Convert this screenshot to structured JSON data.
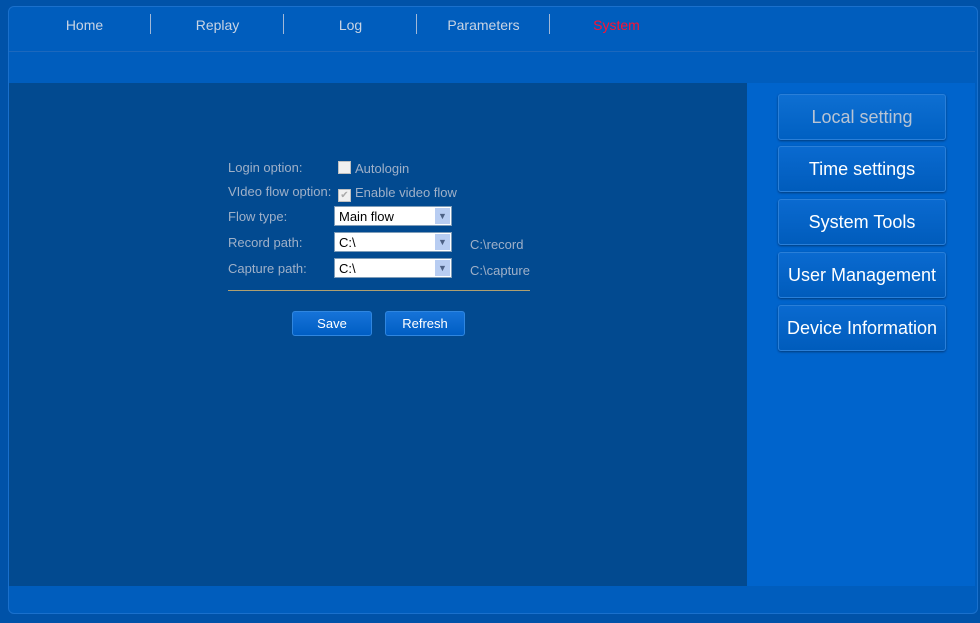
{
  "nav": {
    "items": [
      "Home",
      "Replay",
      "Log",
      "Parameters",
      "System"
    ],
    "active": "System"
  },
  "form": {
    "login_label": "Login option:",
    "autologin": "Autologin",
    "autologin_checked": false,
    "video_label": "VIdeo flow option:",
    "enable_video": "Enable video flow",
    "enable_video_checked": true,
    "flow_label": "Flow type:",
    "flow_value": "Main flow",
    "record_label": "Record path:",
    "record_value": "C:\\",
    "record_path": "C:\\record",
    "capture_label": "Capture path:",
    "capture_value": "C:\\",
    "capture_path": "C:\\capture",
    "save": "Save",
    "refresh": "Refresh"
  },
  "sidebar": {
    "items": [
      "Local setting",
      "Time settings",
      "System Tools",
      "User Management",
      "Device Information"
    ],
    "active": "Local setting"
  },
  "icons": {
    "checkbox": "checkbox-icon",
    "dropdown": "chevron-down-icon"
  },
  "colors": {
    "active_nav": "#ff1030",
    "background": "#005dbd"
  }
}
